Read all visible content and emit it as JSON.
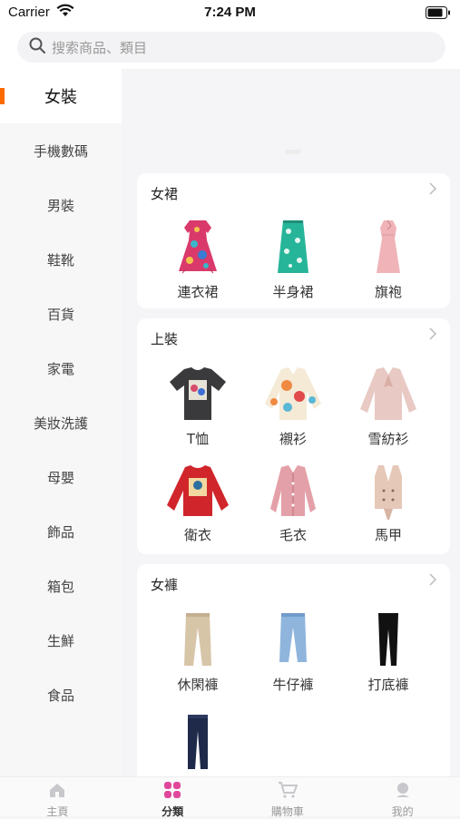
{
  "status_bar": {
    "carrier": "Carrier",
    "time": "7:24 PM"
  },
  "search": {
    "placeholder": "搜索商品、類目",
    "icon": "search-icon"
  },
  "sidebar": {
    "items": [
      {
        "label": "女裝",
        "active": true
      },
      {
        "label": "手機數碼"
      },
      {
        "label": "男裝"
      },
      {
        "label": "鞋靴"
      },
      {
        "label": "百貨"
      },
      {
        "label": "家電"
      },
      {
        "label": "美妝洗護"
      },
      {
        "label": "母嬰"
      },
      {
        "label": "飾品"
      },
      {
        "label": "箱包"
      },
      {
        "label": "生鮮"
      },
      {
        "label": "食品"
      }
    ]
  },
  "sections": [
    {
      "title": "女裙",
      "products": [
        {
          "label": "連衣裙",
          "icon": "floral-dress-icon"
        },
        {
          "label": "半身裙",
          "icon": "skirt-icon"
        },
        {
          "label": "旗袍",
          "icon": "qipao-icon"
        }
      ]
    },
    {
      "title": "上裝",
      "products": [
        {
          "label": "T恤",
          "icon": "tshirt-icon"
        },
        {
          "label": "襯衫",
          "icon": "shirt-icon"
        },
        {
          "label": "雪紡衫",
          "icon": "chiffon-blouse-icon"
        },
        {
          "label": "衛衣",
          "icon": "sweatshirt-icon"
        },
        {
          "label": "毛衣",
          "icon": "cardigan-icon"
        },
        {
          "label": "馬甲",
          "icon": "vest-icon"
        }
      ]
    },
    {
      "title": "女褲",
      "products": [
        {
          "label": "休閑褲",
          "icon": "casual-pants-icon"
        },
        {
          "label": "牛仔褲",
          "icon": "jeans-icon"
        },
        {
          "label": "打底褲",
          "icon": "leggings-icon"
        },
        {
          "label": "",
          "icon": "trousers-icon"
        }
      ]
    }
  ],
  "tabbar": {
    "tabs": [
      {
        "label": "主頁",
        "icon": "home-icon"
      },
      {
        "label": "分類",
        "icon": "category-icon",
        "active": true
      },
      {
        "label": "購物車",
        "icon": "cart-icon"
      },
      {
        "label": "我的",
        "icon": "profile-icon"
      }
    ]
  },
  "colors": {
    "accent": "#ff6a00",
    "category_icon": "#e0479a"
  }
}
